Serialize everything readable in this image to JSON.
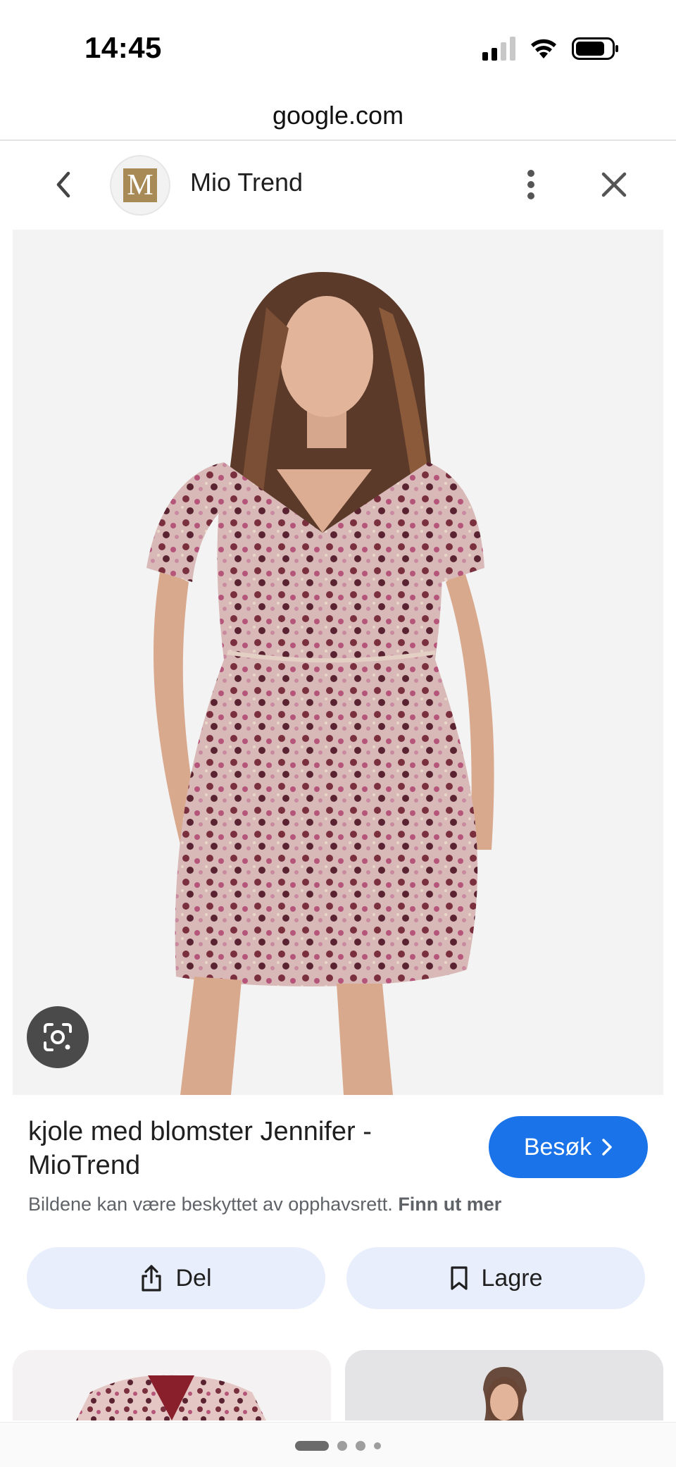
{
  "status_bar": {
    "time": "14:45"
  },
  "browser": {
    "url": "google.com"
  },
  "viewer_header": {
    "logo_letter": "M",
    "site_name": "Mio Trend"
  },
  "image": {
    "subject": "model wearing floral wrap dress"
  },
  "result": {
    "title": "kjole med blomster Jennifer - MioTrend",
    "visit_label": "Besøk",
    "copyright_text": "Bildene kan være beskyttet av opphavsrett.",
    "learn_more_label": "Finn ut mer"
  },
  "actions": {
    "share_label": "Del",
    "save_label": "Lagre"
  },
  "colors": {
    "accent": "#1a73e8",
    "action_bg": "#e8eefb",
    "logo_bg": "#a88a57"
  },
  "icons": {
    "back": "chevron-left-icon",
    "more": "more-vert-icon",
    "close": "close-icon",
    "lens": "google-lens-icon",
    "visit_chevron": "chevron-right-icon",
    "share": "share-icon",
    "save": "bookmark-icon"
  }
}
